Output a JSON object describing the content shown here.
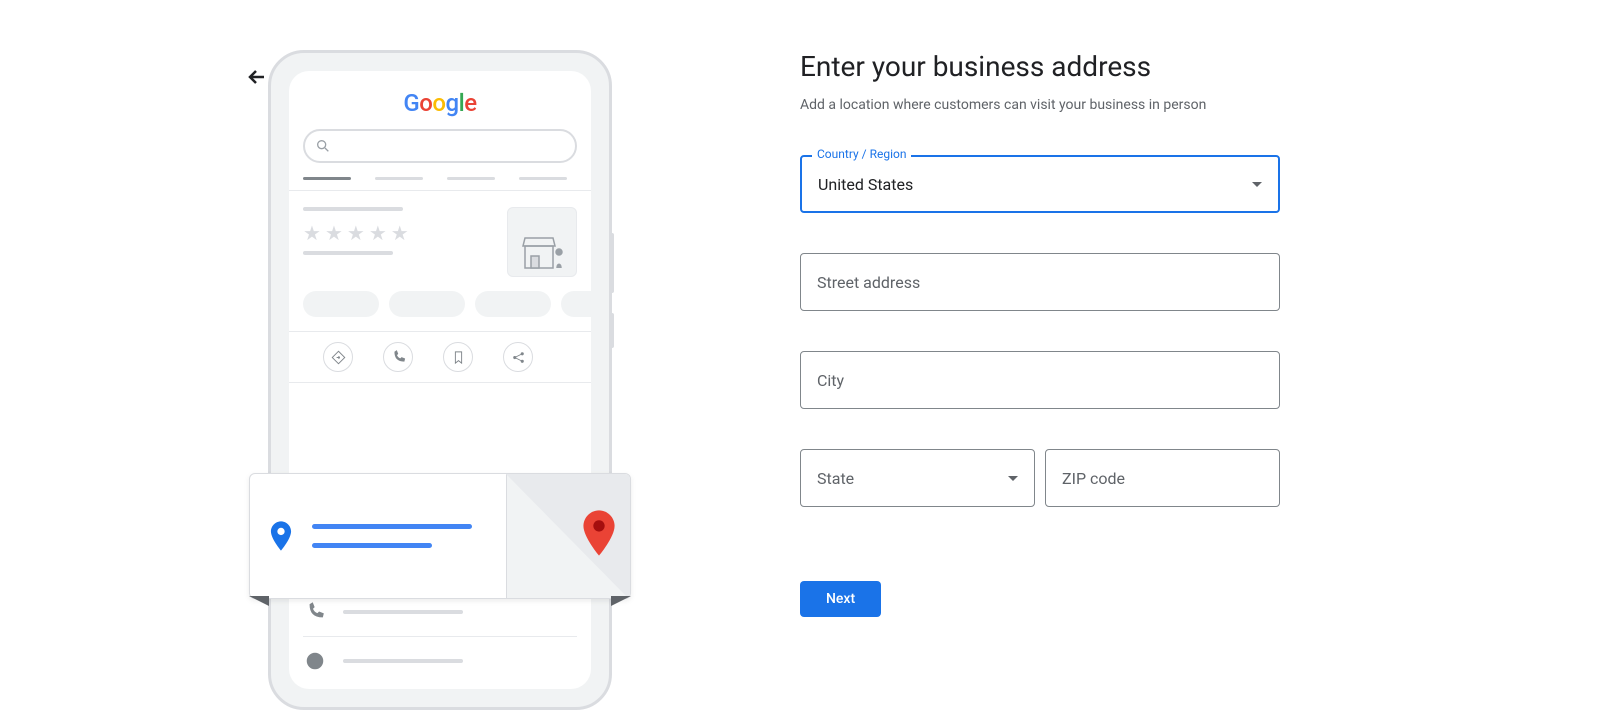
{
  "header": {
    "title": "Enter your business address",
    "subtitle": "Add a location where customers can visit your business in person"
  },
  "form": {
    "country": {
      "label": "Country / Region",
      "value": "United States"
    },
    "street": {
      "placeholder": "Street address"
    },
    "city": {
      "placeholder": "City"
    },
    "state": {
      "placeholder": "State"
    },
    "zip": {
      "placeholder": "ZIP code"
    }
  },
  "buttons": {
    "next": "Next"
  }
}
